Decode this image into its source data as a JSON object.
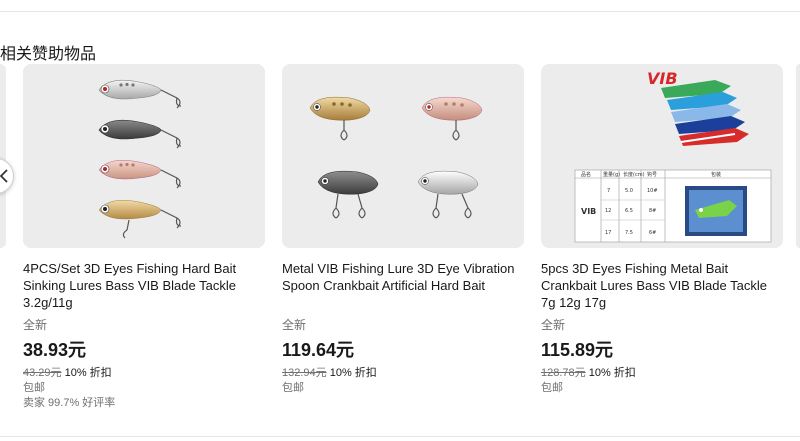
{
  "section": {
    "title": "相关赞助物品"
  },
  "carousel": {
    "prev_icon": "chevron-left-icon",
    "cards": [
      {
        "title": "4PCS/Set 3D Eyes Fishing Hard Bait Sinking Lures Bass VIB Blade Tackle 3.2g/11g",
        "condition": "全新",
        "price": "38.93元",
        "was_price": "43.29元",
        "discount": "10% 折扣",
        "shipping": "包邮",
        "seller": "卖家 99.7% 好评率"
      },
      {
        "title": "Metal VIB Fishing Lure 3D Eye Vibration Spoon Crankbait Artificial Hard Bait",
        "condition": "全新",
        "price": "119.64元",
        "was_price": "132.94元",
        "discount": "10% 折扣",
        "shipping": "包邮"
      },
      {
        "title": "5pcs 3D Eyes Fishing Metal Bait Crankbait Lures Bass VIB Blade Tackle 7g 12g 17g",
        "condition": "全新",
        "price": "115.89元",
        "was_price": "128.78元",
        "discount": "10% 折扣",
        "shipping": "包邮",
        "image_text": {
          "brand": "VIB",
          "headers": [
            "品名",
            "重量(g)",
            "长度(cm)",
            "钩号",
            "包装"
          ],
          "product": "VIB",
          "rows": [
            [
              "7",
              "5.0",
              "10#"
            ],
            [
              "12",
              "6.5",
              "8#"
            ],
            [
              "17",
              "7.5",
              "6#"
            ]
          ]
        }
      }
    ]
  }
}
